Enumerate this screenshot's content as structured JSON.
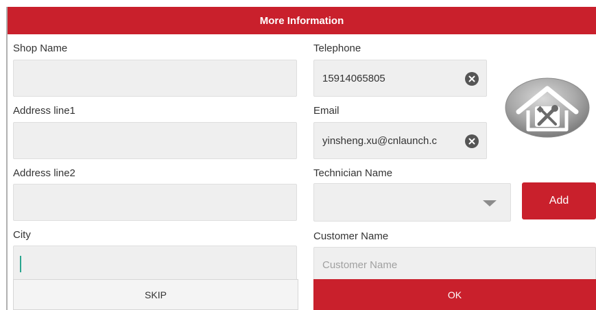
{
  "window": {
    "title": "More Information"
  },
  "form": {
    "shop_name": {
      "label": "Shop Name",
      "value": ""
    },
    "address1": {
      "label": "Address line1",
      "value": ""
    },
    "address2": {
      "label": "Address line2",
      "value": ""
    },
    "city": {
      "label": "City",
      "value": ""
    },
    "telephone": {
      "label": "Telephone",
      "value": "15914065805"
    },
    "email": {
      "label": "Email",
      "value": "yinsheng.xu@cnlaunch.c"
    },
    "technician": {
      "label": "Technician Name",
      "selected": ""
    },
    "customer": {
      "label": "Customer Name",
      "placeholder": "Customer Name",
      "value": ""
    }
  },
  "buttons": {
    "add": "Add",
    "skip": "SKIP",
    "ok": "OK"
  },
  "icons": {
    "clear": "clear-x-icon",
    "dropdown": "chevron-down-icon",
    "shop": "repair-shop-icon"
  },
  "colors": {
    "accent": "#c9202c",
    "field_bg": "#efefef",
    "caret": "#2aa68f"
  }
}
